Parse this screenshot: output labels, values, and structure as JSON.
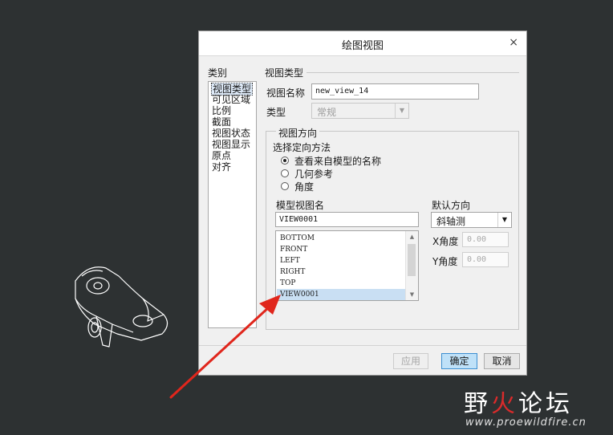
{
  "dialog": {
    "title": "绘图视图",
    "close": "×"
  },
  "categories": {
    "heading": "类别",
    "items": [
      "视图类型",
      "可见区域",
      "比例",
      "截面",
      "视图状态",
      "视图显示",
      "原点",
      "对齐"
    ],
    "selected_index": 0
  },
  "view_type": {
    "section_label": "视图类型",
    "name_label": "视图名称",
    "name_value": "new_view_14",
    "type_label": "类型",
    "type_value": "常规"
  },
  "orientation": {
    "group_label": "视图方向",
    "method_label": "选择定向方法",
    "options": [
      {
        "label": "查看来自模型的名称",
        "selected": true
      },
      {
        "label": "几何参考",
        "selected": false
      },
      {
        "label": "角度",
        "selected": false
      }
    ],
    "model_view_label": "模型视图名",
    "model_view_value": "VIEW0001",
    "view_list": [
      "BOTTOM",
      "FRONT",
      "LEFT",
      "RIGHT",
      "TOP",
      "VIEW0001"
    ],
    "view_list_selected": 5,
    "default_dir_label": "默认方向",
    "default_dir_value": "斜轴测",
    "x_angle_label": "X角度",
    "x_angle_value": "0.00",
    "y_angle_label": "Y角度",
    "y_angle_value": "0.00"
  },
  "buttons": {
    "apply": "应用",
    "ok": "确定",
    "cancel": "取消"
  },
  "watermark": {
    "part1": "野",
    "part2": "火",
    "part3": "论坛",
    "url": "www.proewildfire.cn"
  },
  "colors": {
    "background": "#2d3132",
    "arrow": "#e0261c",
    "selection": "#c9dff3",
    "default_button": "#bfe1f8"
  }
}
